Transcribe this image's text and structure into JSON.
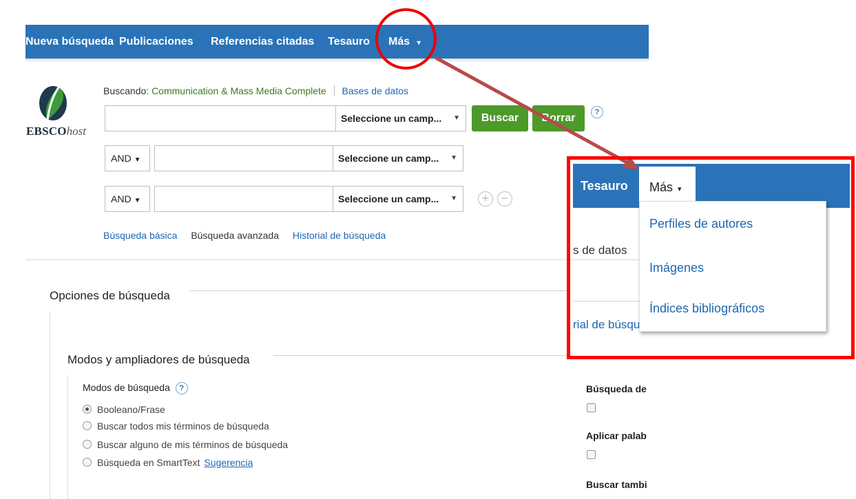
{
  "topnav": {
    "items": [
      "Nueva búsqueda",
      "Publicaciones",
      "Referencias citadas",
      "Tesauro",
      "Más"
    ],
    "mas_caret": "▾"
  },
  "logo": {
    "brand_bold": "EBSCO",
    "brand_italic": "host"
  },
  "searching": {
    "label": "Buscando:",
    "database": "Communication & Mass Media Complete",
    "databases_link": "Bases de datos"
  },
  "search_rows": [
    {
      "value": "",
      "field": "Seleccione un camp..."
    },
    {
      "operator": "AND",
      "value": "",
      "field": "Seleccione un camp..."
    },
    {
      "operator": "AND",
      "value": "",
      "field": "Seleccione un camp..."
    }
  ],
  "buttons": {
    "search": "Buscar",
    "clear": "Borrar",
    "help": "?",
    "add": "+",
    "remove": "−"
  },
  "links": {
    "basic": "Búsqueda básica",
    "advanced": "Búsqueda avanzada",
    "history": "Historial de búsqueda"
  },
  "options": {
    "title": "Opciones de búsqueda",
    "modes_section": "Modos y ampliadores de búsqueda",
    "modes_label": "Modos de búsqueda",
    "modes": [
      {
        "label": "Booleano/Frase",
        "selected": true
      },
      {
        "label": "Buscar todos mis términos de búsqueda",
        "selected": false
      },
      {
        "label": "Buscar alguno de mis términos de búsqueda",
        "selected": false
      },
      {
        "label": "Búsqueda en SmartText",
        "selected": false
      }
    ],
    "suggestion_link": "Sugerencia",
    "right_labels": [
      "Búsqueda de",
      "Aplicar palab",
      "Buscar tambi"
    ]
  },
  "zoom_inset": {
    "tesauro": "Tesauro",
    "mas": "Más",
    "menu_items": [
      "Perfiles de autores",
      "Imágenes",
      "Índices bibliográficos"
    ],
    "fragment_databases": "s de datos",
    "fragment_history": "rial de búsqu"
  },
  "colors": {
    "nav_blue": "#2a73b8",
    "button_green": "#4c9a2a",
    "link_blue": "#1e67b0",
    "annotation_red": "#ff0000"
  }
}
